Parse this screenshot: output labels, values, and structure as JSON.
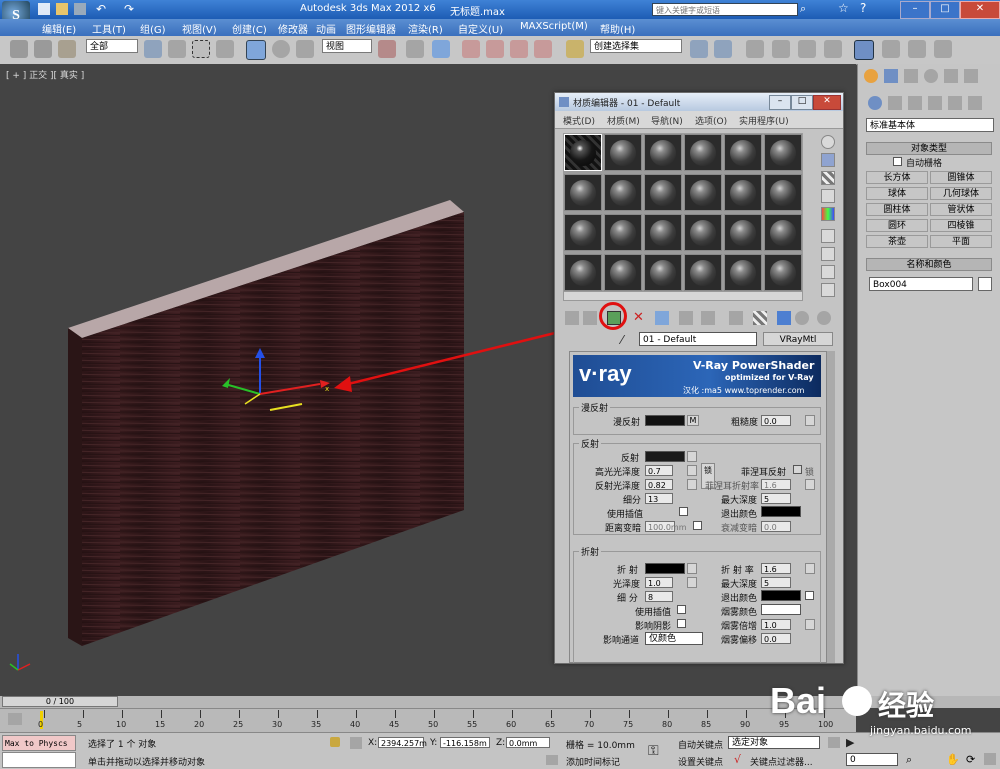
{
  "window": {
    "title": "Autodesk 3ds Max  2012 x6",
    "file_name": "无标题.max",
    "search_placeholder": "键入关键字或短语"
  },
  "menu": [
    "编辑(E)",
    "工具(T)",
    "组(G)",
    "视图(V)",
    "创建(C)",
    "修改器",
    "动画",
    "图形编辑器",
    "渲染(R)",
    "自定义(U)",
    "MAXScript(M)",
    "帮助(H)"
  ],
  "toolbar": {
    "selection_filter": "全部",
    "reference_coord": "视图",
    "named_selection": "创建选择集"
  },
  "viewport": {
    "label": "[ + ] 正交 ][ 真实 ]"
  },
  "command_panel": {
    "dropdown": "标准基本体",
    "object_type_header": "对象类型",
    "auto_grid": "自动栅格",
    "buttons": [
      "长方体",
      "圆锥体",
      "球体",
      "几何球体",
      "圆柱体",
      "管状体",
      "圆环",
      "四棱锥",
      "茶壶",
      "平面"
    ],
    "name_color_header": "名称和颜色",
    "object_name": "Box004"
  },
  "material_editor": {
    "title": "材质编辑器 - 01 - Default",
    "menu": [
      "模式(D)",
      "材质(M)",
      "导航(N)",
      "选项(O)",
      "实用程序(U)"
    ],
    "material_name": "01 - Default",
    "material_type": "VRayMtl",
    "banner_brand": "v·ray",
    "banner_title": "V-Ray PowerShader",
    "banner_sub": "optimized for V-Ray",
    "banner_credit": "汉化 :ma5 www.toprender.com",
    "diffuse": {
      "header": "漫反射",
      "diffuse_label": "漫反射",
      "map_btn": "M",
      "roughness_label": "粗糙度",
      "roughness": "0.0"
    },
    "reflection": {
      "header": "反射",
      "reflect_label": "反射",
      "hilight_label": "高光光泽度",
      "hilight": "0.7",
      "lock_label": "锁",
      "fresnel_label": "菲涅耳反射",
      "lock2_label": "锁",
      "refl_gloss_label": "反射光泽度",
      "refl_gloss": "0.82",
      "fresnel_ior_label": "菲涅耳折射率",
      "fresnel_ior": "1.6",
      "subdivs_label": "细分",
      "subdivs": "13",
      "max_depth_label": "最大深度",
      "max_depth": "5",
      "interp_label": "使用插值",
      "exit_color_label": "退出颜色",
      "dim_dist_label": "距离变暗",
      "dim_dist": "100.0mm",
      "dim_falloff_label": "衰减变暗",
      "dim_falloff": "0.0"
    },
    "refraction": {
      "header": "折射",
      "refract_label": "折 射",
      "ior_label": "折 射 率",
      "ior": "1.6",
      "gloss_label": "光泽度",
      "gloss": "1.0",
      "max_depth_label": "最大深度",
      "max_depth": "5",
      "subdivs_label": "细 分",
      "subdivs": "8",
      "exit_color_label": "退出颜色",
      "interp_label": "使用插值",
      "fog_color_label": "烟雾颜色",
      "shadow_label": "影响阴影",
      "fog_mult_label": "烟雾倍增",
      "fog_mult": "1.0",
      "channel_label": "影响通道",
      "channel": "仅颜色",
      "fog_bias_label": "烟雾偏移",
      "fog_bias": "0.0"
    }
  },
  "timeline": {
    "frame": "0 / 100",
    "ticks": [
      "0",
      "5",
      "10",
      "15",
      "20",
      "25",
      "30",
      "35",
      "40",
      "45",
      "50",
      "55",
      "60",
      "65",
      "70",
      "75",
      "80",
      "85",
      "90",
      "95",
      "100"
    ]
  },
  "status": {
    "maxscript": "Max to Physcs (",
    "selection": "选择了 1 个 对象",
    "prompt": "单击并拖动以选择并移动对象",
    "x_label": "X:",
    "x": "2394.257m",
    "y_label": "Y:",
    "y": "-116.158m",
    "z_label": "Z:",
    "z": "0.0mm",
    "grid": "栅格 = 10.0mm",
    "add_time_tag": "添加时间标记",
    "auto_key": "自动关键点",
    "auto_key_target": "选定对象",
    "set_key": "设置关键点",
    "key_filters": "关键点过滤器...",
    "frame_field": "0"
  },
  "watermark": {
    "brand": "Bai",
    "suffix": "经验",
    "url": "jingyan.baidu.com"
  }
}
